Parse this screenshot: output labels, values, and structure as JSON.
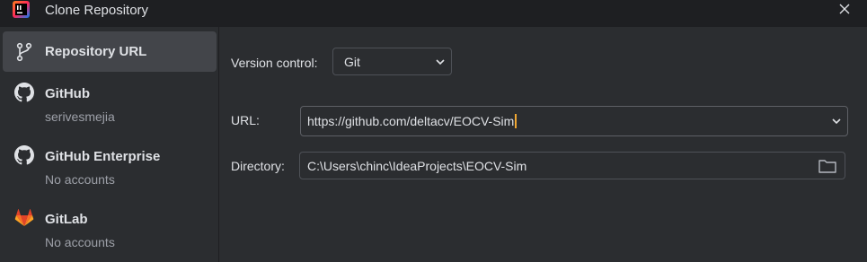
{
  "window": {
    "title": "Clone Repository",
    "app_icon": "intellij-idea-icon",
    "close_icon": "close-icon"
  },
  "sidebar": {
    "items": [
      {
        "label": "Repository URL",
        "sub": "",
        "icon": "branch-icon",
        "selected": true
      },
      {
        "label": "GitHub",
        "sub": "serivesmejia",
        "icon": "github-icon",
        "selected": false
      },
      {
        "label": "GitHub Enterprise",
        "sub": "No accounts",
        "icon": "github-icon",
        "selected": false
      },
      {
        "label": "GitLab",
        "sub": "No accounts",
        "icon": "gitlab-icon",
        "selected": false
      }
    ]
  },
  "form": {
    "version_control_label": "Version control:",
    "version_control_value": "Git",
    "url_label": "URL:",
    "url_value": "https://github.com/deltacv/EOCV-Sim",
    "directory_label": "Directory:",
    "directory_value": "C:\\Users\\chinc\\IdeaProjects\\EOCV-Sim"
  },
  "colors": {
    "background": "#1e1f22",
    "panel": "#2b2d30",
    "selected_item": "#43454a",
    "caret": "#f0a732",
    "gitlab_orange": "#e24329"
  }
}
